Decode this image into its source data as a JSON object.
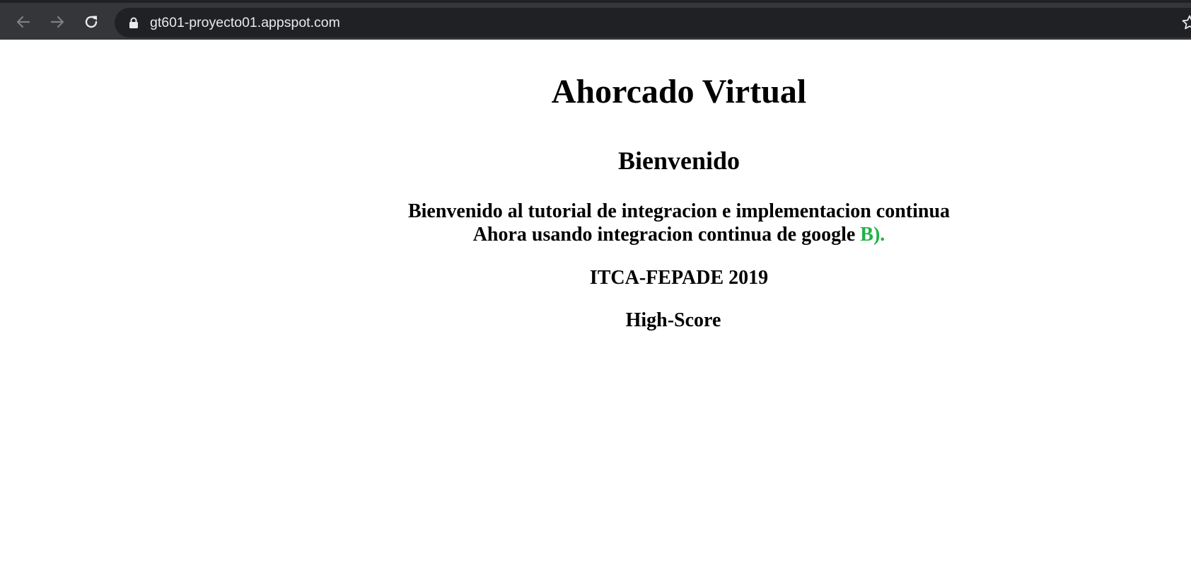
{
  "browser": {
    "url": "gt601-proyecto01.appspot.com",
    "theme": {
      "toolbar_bg": "#35363a",
      "omnibox_bg": "#202124",
      "text": "#e8eaed"
    }
  },
  "page": {
    "title": "Ahorcado Virtual",
    "subtitle": "Bienvenido",
    "line1": "Bienvenido al tutorial de integracion e implementacion continua",
    "line2_prefix": "Ahora usando integracion continua de google ",
    "line2_highlight": "B).",
    "highlight_color": "#1db346",
    "footer": "ITCA-FEPADE 2019",
    "highscore": "High-Score"
  }
}
